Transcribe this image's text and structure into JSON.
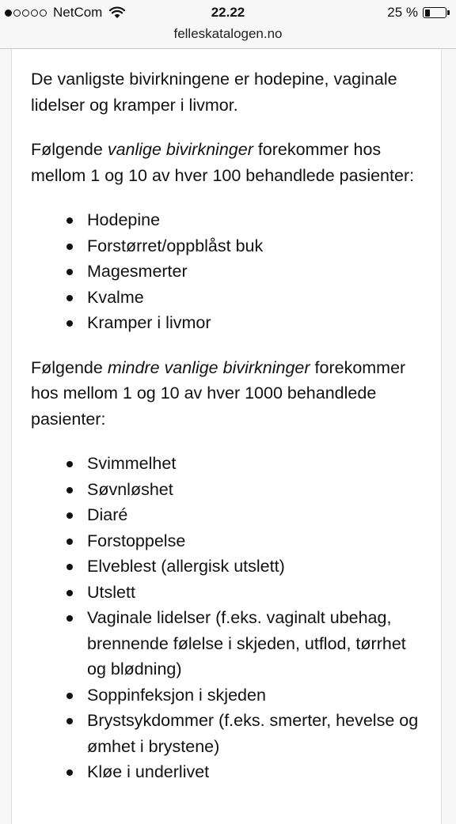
{
  "status_bar": {
    "signal_bars_filled": 1,
    "signal_bars_total": 5,
    "carrier": "NetCom",
    "time": "22.22",
    "battery_percent_label": "25 %",
    "battery_level": 0.25
  },
  "url_bar": {
    "domain": "felleskatalogen.no"
  },
  "content": {
    "paragraph1": "De vanligste bivirkningene er hodepine, vaginale lidelser og kramper i livmor.",
    "paragraph2": {
      "before": "Følgende ",
      "emphasis": "vanlige bivirkninger",
      "after": " forekommer hos mellom 1 og 10 av hver 100 behandlede pasienter:"
    },
    "list1": [
      "Hodepine",
      "Forstørret/oppblåst buk",
      "Magesmerter",
      "Kvalme",
      "Kramper i livmor"
    ],
    "paragraph3": {
      "before": "Følgende ",
      "emphasis": "mindre vanlige bivirkninger",
      "after": " forekommer hos mellom 1 og 10 av hver 1000 behandlede pasienter:"
    },
    "list2": [
      "Svimmelhet",
      "Søvnløshet",
      "Diaré",
      "Forstoppelse",
      "Elveblest (allergisk utslett)",
      "Utslett",
      "Vaginale lidelser (f.eks. vaginalt ubehag, brennende følelse i skjeden, utflod, tørrhet og blødning)",
      "Soppinfeksjon i skjeden",
      "Brystsykdommer (f.eks. smerter, hevelse og ømhet i brystene)",
      "Kløe i underlivet"
    ]
  }
}
